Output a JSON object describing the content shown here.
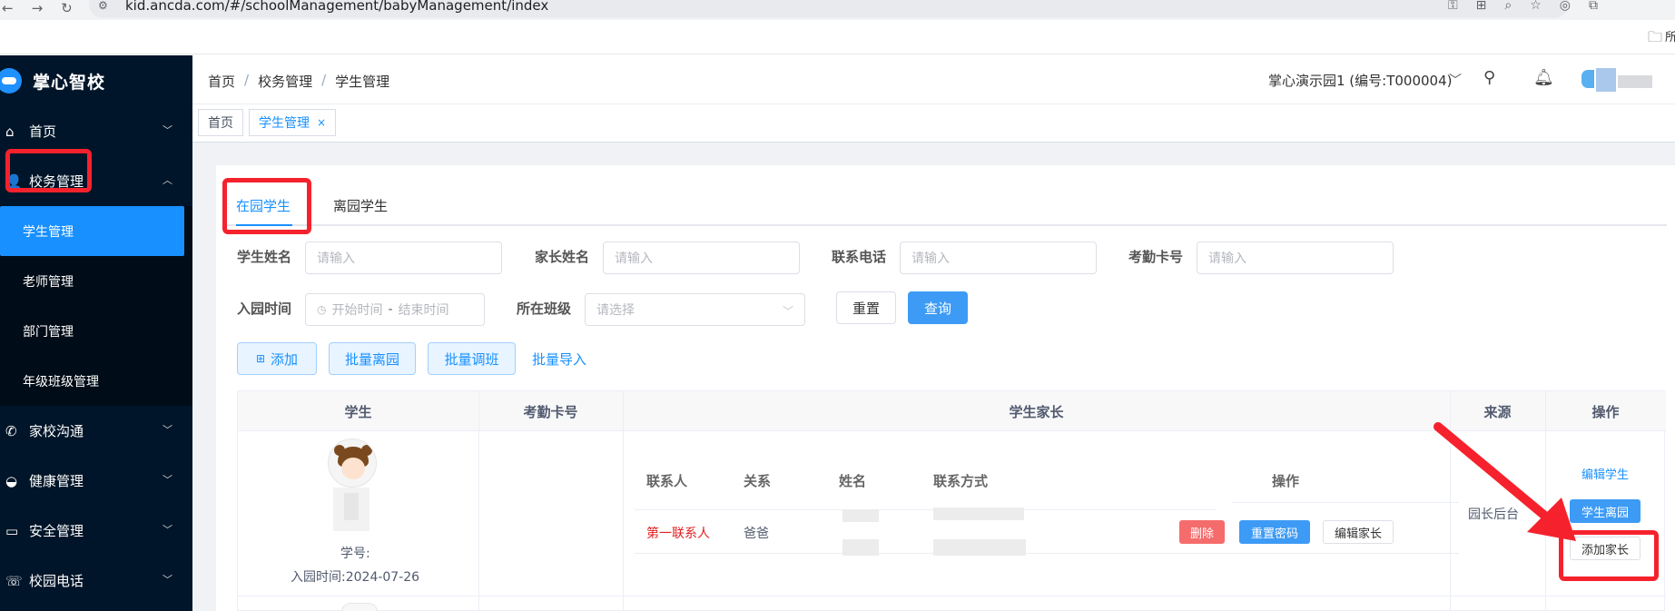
{
  "browser": {
    "url": "kid.ancda.com/#/schoolManagement/babyManagement/index",
    "bookmark_folder_label": "所"
  },
  "sidebar": {
    "brand": "掌心智校",
    "items": [
      {
        "label": "首页",
        "icon": "home-icon"
      },
      {
        "label": "校务管理",
        "icon": "user-icon"
      },
      {
        "label": "家校沟通",
        "icon": "phone-icon"
      },
      {
        "label": "健康管理",
        "icon": "bowl-icon"
      },
      {
        "label": "安全管理",
        "icon": "folder-icon"
      },
      {
        "label": "校园电话",
        "icon": "phone-icon"
      }
    ],
    "submenu": [
      "学生管理",
      "老师管理",
      "部门管理",
      "年级班级管理"
    ]
  },
  "header": {
    "breadcrumb": [
      "首页",
      "校务管理",
      "学生管理"
    ],
    "school": "掌心演示园1 (编号:T000004)"
  },
  "tags": [
    {
      "label": "首页"
    },
    {
      "label": "学生管理",
      "close": "×"
    }
  ],
  "tabs": [
    "在园学生",
    "离园学生"
  ],
  "filters": {
    "student_name_label": "学生姓名",
    "parent_name_label": "家长姓名",
    "phone_label": "联系电话",
    "card_label": "考勤卡号",
    "placeholder_input": "请输入",
    "enroll_label": "入园时间",
    "start_placeholder": "开始时间",
    "range_sep": "-",
    "end_placeholder": "结束时间",
    "class_label": "所在班级",
    "class_placeholder": "请选择",
    "reset": "重置",
    "search": "查询"
  },
  "actions": {
    "add": "添加",
    "batch_leave": "批量离园",
    "batch_transfer": "批量调班",
    "batch_import": "批量导入"
  },
  "table": {
    "headers": [
      "学生",
      "考勤卡号",
      "学生家长",
      "来源",
      "操作"
    ],
    "row": {
      "student_no": "学号:",
      "enroll_date": "入园时间:2024-07-26",
      "source": "园长后台",
      "edit_student": "编辑学生",
      "student_leave": "学生离园",
      "add_parent": "添加家长"
    },
    "parent_headers": [
      "联系人",
      "关系",
      "姓名",
      "联系方式",
      "操作"
    ],
    "parent_row": {
      "contact": "第一联系人",
      "relation": "爸爸",
      "delete": "删除",
      "reset_pwd": "重置密码",
      "edit_parent": "编辑家长"
    }
  },
  "colors": {
    "sidebar_bg": "#001529",
    "primary": "#1890ff",
    "highlight": "#f5222d"
  }
}
